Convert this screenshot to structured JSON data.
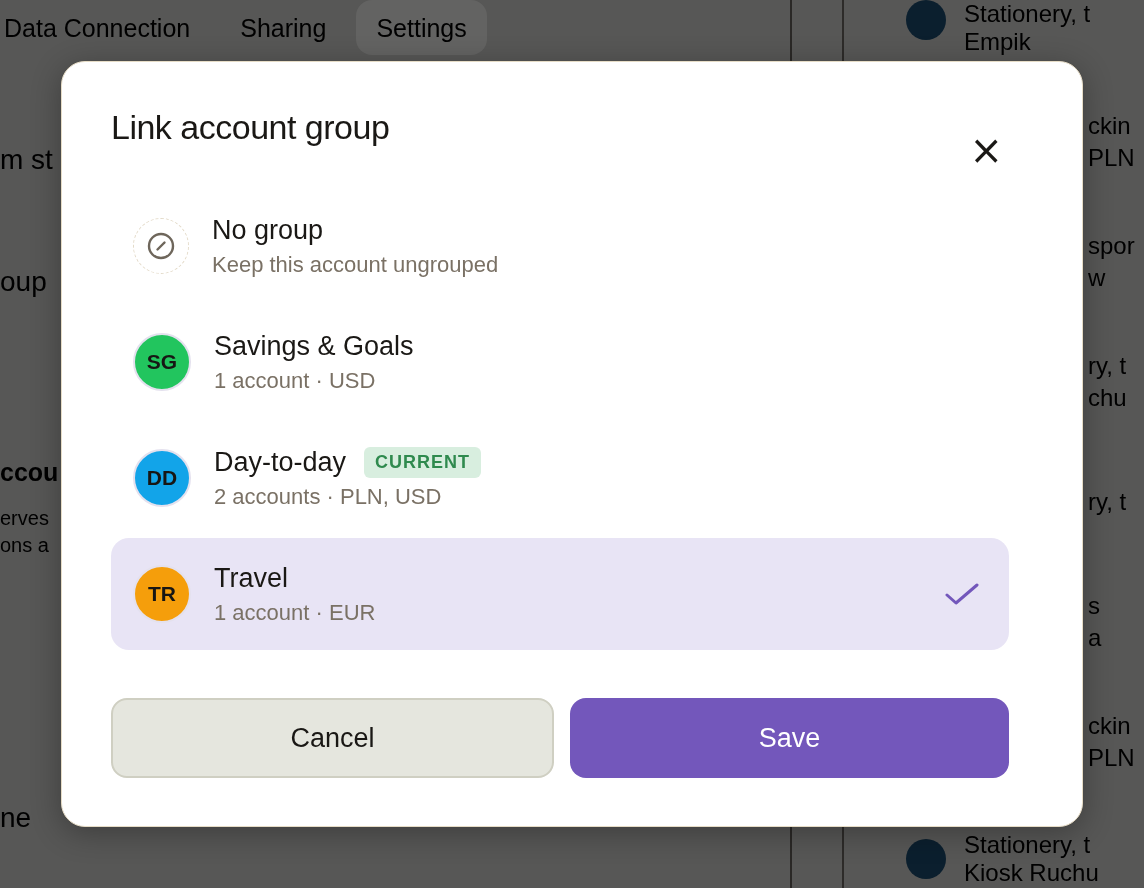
{
  "background": {
    "tabs": [
      {
        "label": "Data Connection",
        "selected": false
      },
      {
        "label": "Sharing",
        "selected": false
      },
      {
        "label": "Settings",
        "selected": true
      }
    ],
    "main_fragments": [
      {
        "kind": "label",
        "text": "m st"
      },
      {
        "kind": "label",
        "text": "oup"
      },
      {
        "kind": "heading",
        "text": "ccou"
      },
      {
        "kind": "body",
        "text": "erves"
      },
      {
        "kind": "body",
        "text": "ons a"
      },
      {
        "kind": "label",
        "text": "ne"
      }
    ],
    "side_items": [
      {
        "kind": "full",
        "title": "Stationery, t",
        "subtitle": "Empik"
      },
      {
        "kind": "fragment",
        "title": "ckin",
        "subtitle": "PLN"
      },
      {
        "kind": "fragment",
        "title": "spor",
        "subtitle": "w"
      },
      {
        "kind": "fragment",
        "title": "ry, t",
        "subtitle": "chu"
      },
      {
        "kind": "fragment",
        "title": "ry, t"
      },
      {
        "kind": "fragment",
        "title": "s",
        "subtitle": "a"
      },
      {
        "kind": "fragment",
        "title": "ckin",
        "subtitle": "PLN"
      },
      {
        "kind": "full",
        "title": "Stationery, t",
        "subtitle": "Kiosk Ruchu"
      }
    ]
  },
  "dialog": {
    "title": "Link account group",
    "close": "×",
    "options": [
      {
        "kind": "none",
        "name": "No group",
        "detail": "Keep this account ungrouped",
        "selected": false
      },
      {
        "kind": "group",
        "initials": "SG",
        "color": "#22c55e",
        "name": "Savings & Goals",
        "detail": "1 account · USD",
        "selected": false
      },
      {
        "kind": "group",
        "initials": "DD",
        "color": "#12a4e9",
        "name": "Day-to-day",
        "badge": "CURRENT",
        "detail": "2 accounts · PLN, USD",
        "selected": false
      },
      {
        "kind": "group",
        "initials": "TR",
        "color": "#f59e0b",
        "name": "Travel",
        "detail": "1 account · EUR",
        "selected": true
      }
    ],
    "buttons": [
      {
        "kind": "secondary",
        "label": "Cancel"
      },
      {
        "kind": "primary",
        "label": "Save"
      }
    ]
  }
}
